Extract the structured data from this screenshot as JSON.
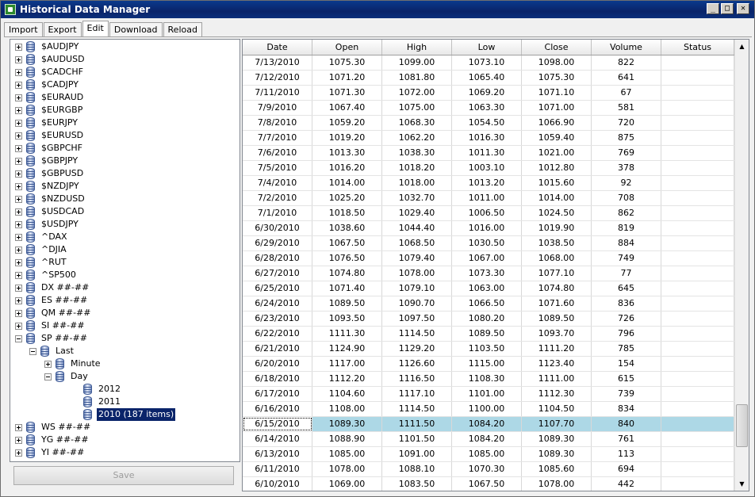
{
  "window": {
    "title": "Historical Data Manager",
    "buttons": {
      "minimize": "_",
      "maximize": "□",
      "close": "✕"
    }
  },
  "tabs": [
    "Import",
    "Export",
    "Edit",
    "Download",
    "Reload"
  ],
  "active_tab": "Edit",
  "tree": [
    {
      "label": "$AUDJPY",
      "level": 0,
      "expander": "plus"
    },
    {
      "label": "$AUDUSD",
      "level": 0,
      "expander": "plus"
    },
    {
      "label": "$CADCHF",
      "level": 0,
      "expander": "plus"
    },
    {
      "label": "$CADJPY",
      "level": 0,
      "expander": "plus"
    },
    {
      "label": "$EURAUD",
      "level": 0,
      "expander": "plus"
    },
    {
      "label": "$EURGBP",
      "level": 0,
      "expander": "plus"
    },
    {
      "label": "$EURJPY",
      "level": 0,
      "expander": "plus"
    },
    {
      "label": "$EURUSD",
      "level": 0,
      "expander": "plus"
    },
    {
      "label": "$GBPCHF",
      "level": 0,
      "expander": "plus"
    },
    {
      "label": "$GBPJPY",
      "level": 0,
      "expander": "plus"
    },
    {
      "label": "$GBPUSD",
      "level": 0,
      "expander": "plus"
    },
    {
      "label": "$NZDJPY",
      "level": 0,
      "expander": "plus"
    },
    {
      "label": "$NZDUSD",
      "level": 0,
      "expander": "plus"
    },
    {
      "label": "$USDCAD",
      "level": 0,
      "expander": "plus"
    },
    {
      "label": "$USDJPY",
      "level": 0,
      "expander": "plus"
    },
    {
      "label": "^DAX",
      "level": 0,
      "expander": "plus"
    },
    {
      "label": "^DJIA",
      "level": 0,
      "expander": "plus"
    },
    {
      "label": "^RUT",
      "level": 0,
      "expander": "plus"
    },
    {
      "label": "^SP500",
      "level": 0,
      "expander": "plus"
    },
    {
      "label": "DX ##-##",
      "level": 0,
      "expander": "plus"
    },
    {
      "label": "ES ##-##",
      "level": 0,
      "expander": "plus"
    },
    {
      "label": "QM ##-##",
      "level": 0,
      "expander": "plus"
    },
    {
      "label": "SI ##-##",
      "level": 0,
      "expander": "plus"
    },
    {
      "label": "SP ##-##",
      "level": 0,
      "expander": "minus"
    },
    {
      "label": "Last",
      "level": 1,
      "expander": "minus"
    },
    {
      "label": "Minute",
      "level": 2,
      "expander": "plus"
    },
    {
      "label": "Day",
      "level": 2,
      "expander": "minus"
    },
    {
      "label": "2012",
      "level": 3,
      "expander": "none"
    },
    {
      "label": "2011",
      "level": 3,
      "expander": "none"
    },
    {
      "label": "2010 (187 items)",
      "level": 3,
      "expander": "none",
      "selected": true
    },
    {
      "label": "WS ##-##",
      "level": 0,
      "expander": "plus"
    },
    {
      "label": "YG ##-##",
      "level": 0,
      "expander": "plus"
    },
    {
      "label": "YI ##-##",
      "level": 0,
      "expander": "plus"
    }
  ],
  "save_label": "Save",
  "grid": {
    "columns": [
      "Date",
      "Open",
      "High",
      "Low",
      "Close",
      "Volume",
      "Status"
    ],
    "selected_row": "6/15/2010",
    "rows": [
      [
        "7/13/2010",
        "1075.30",
        "1099.00",
        "1073.10",
        "1098.00",
        "822",
        ""
      ],
      [
        "7/12/2010",
        "1071.20",
        "1081.80",
        "1065.40",
        "1075.30",
        "641",
        ""
      ],
      [
        "7/11/2010",
        "1071.30",
        "1072.00",
        "1069.20",
        "1071.10",
        "67",
        ""
      ],
      [
        "7/9/2010",
        "1067.40",
        "1075.00",
        "1063.30",
        "1071.00",
        "581",
        ""
      ],
      [
        "7/8/2010",
        "1059.20",
        "1068.30",
        "1054.50",
        "1066.90",
        "720",
        ""
      ],
      [
        "7/7/2010",
        "1019.20",
        "1062.20",
        "1016.30",
        "1059.40",
        "875",
        ""
      ],
      [
        "7/6/2010",
        "1013.30",
        "1038.30",
        "1011.30",
        "1021.00",
        "769",
        ""
      ],
      [
        "7/5/2010",
        "1016.20",
        "1018.20",
        "1003.10",
        "1012.80",
        "378",
        ""
      ],
      [
        "7/4/2010",
        "1014.00",
        "1018.00",
        "1013.20",
        "1015.60",
        "92",
        ""
      ],
      [
        "7/2/2010",
        "1025.20",
        "1032.70",
        "1011.00",
        "1014.00",
        "708",
        ""
      ],
      [
        "7/1/2010",
        "1018.50",
        "1029.40",
        "1006.50",
        "1024.50",
        "862",
        ""
      ],
      [
        "6/30/2010",
        "1038.60",
        "1044.40",
        "1016.00",
        "1019.90",
        "819",
        ""
      ],
      [
        "6/29/2010",
        "1067.50",
        "1068.50",
        "1030.50",
        "1038.50",
        "884",
        ""
      ],
      [
        "6/28/2010",
        "1076.50",
        "1079.40",
        "1067.00",
        "1068.00",
        "749",
        ""
      ],
      [
        "6/27/2010",
        "1074.80",
        "1078.00",
        "1073.30",
        "1077.10",
        "77",
        ""
      ],
      [
        "6/25/2010",
        "1071.40",
        "1079.10",
        "1063.00",
        "1074.80",
        "645",
        ""
      ],
      [
        "6/24/2010",
        "1089.50",
        "1090.70",
        "1066.50",
        "1071.60",
        "836",
        ""
      ],
      [
        "6/23/2010",
        "1093.50",
        "1097.50",
        "1080.20",
        "1089.50",
        "726",
        ""
      ],
      [
        "6/22/2010",
        "1111.30",
        "1114.50",
        "1089.50",
        "1093.70",
        "796",
        ""
      ],
      [
        "6/21/2010",
        "1124.90",
        "1129.20",
        "1103.50",
        "1111.20",
        "785",
        ""
      ],
      [
        "6/20/2010",
        "1117.00",
        "1126.60",
        "1115.00",
        "1123.40",
        "154",
        ""
      ],
      [
        "6/18/2010",
        "1112.20",
        "1116.50",
        "1108.30",
        "1111.00",
        "615",
        ""
      ],
      [
        "6/17/2010",
        "1104.60",
        "1117.10",
        "1101.00",
        "1112.30",
        "739",
        ""
      ],
      [
        "6/16/2010",
        "1108.00",
        "1114.50",
        "1100.00",
        "1104.50",
        "834",
        ""
      ],
      [
        "6/15/2010",
        "1089.30",
        "1111.50",
        "1084.20",
        "1107.70",
        "840",
        ""
      ],
      [
        "6/14/2010",
        "1088.90",
        "1101.50",
        "1084.20",
        "1089.30",
        "761",
        ""
      ],
      [
        "6/13/2010",
        "1085.00",
        "1091.00",
        "1085.00",
        "1089.30",
        "113",
        ""
      ],
      [
        "6/11/2010",
        "1078.00",
        "1088.10",
        "1070.30",
        "1085.60",
        "694",
        ""
      ],
      [
        "6/10/2010",
        "1069.00",
        "1083.50",
        "1067.50",
        "1078.00",
        "442",
        ""
      ]
    ]
  }
}
